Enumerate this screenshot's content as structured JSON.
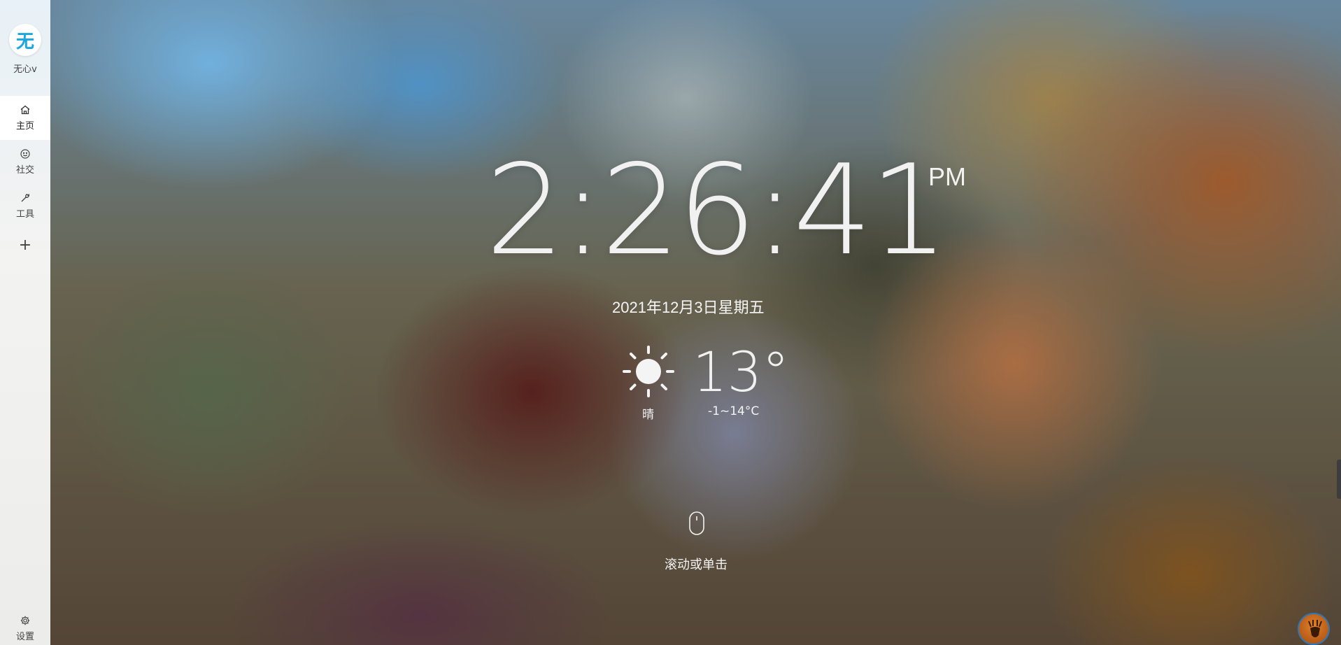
{
  "user": {
    "name": "无心v",
    "avatar_char": "无"
  },
  "sidebar": {
    "items": [
      {
        "label": "主页",
        "icon": "home-icon",
        "active": true
      },
      {
        "label": "社交",
        "icon": "smile-icon",
        "active": false
      },
      {
        "label": "工具",
        "icon": "wrench-icon",
        "active": false
      }
    ],
    "add_label": "+",
    "settings_label": "设置"
  },
  "clock": {
    "time": "2:26:41",
    "ampm": "PM"
  },
  "date": "2021年12月3日星期五",
  "weather": {
    "condition": "晴",
    "temperature": "13°",
    "range": "-1~14°C",
    "icon": "sun-icon"
  },
  "hint": {
    "text": "滚动或单击",
    "icon": "mouse-icon"
  },
  "colors": {
    "accent": "#18a7e0",
    "text_light": "#f1f1f1"
  }
}
